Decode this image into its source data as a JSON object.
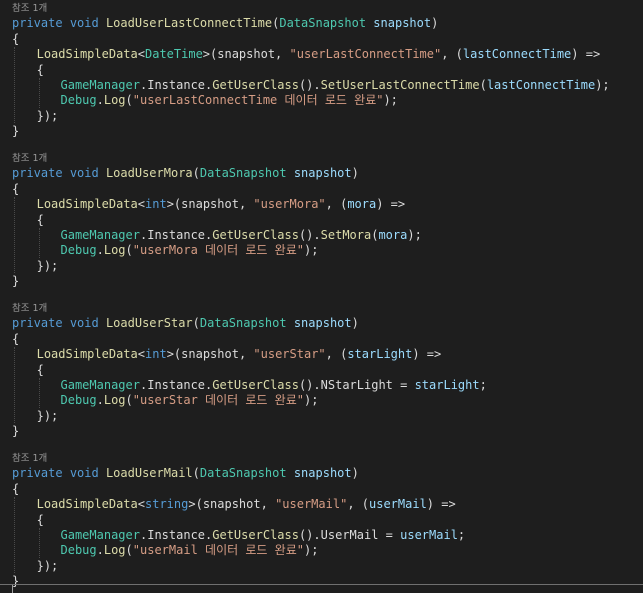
{
  "theme": {
    "background": "#1e1e1e",
    "keyword": "#569cd6",
    "type": "#4ec9b0",
    "method": "#dcdcaa",
    "string": "#d69d85",
    "parameter": "#9cdcfe",
    "text": "#dcdcdc",
    "codelens": "#999999"
  },
  "blocks": [
    {
      "references": "참조 1개",
      "modifier": "private",
      "return_type": "void",
      "method_name": "LoadUserLastConnectTime",
      "param_type": "DataSnapshot",
      "param_name": "snapshot",
      "call_name": "LoadSimpleData",
      "generic_type": "DateTime",
      "call_arg_snapshot": "snapshot",
      "key_string": "\"userLastConnectTime\"",
      "lambda_param": "lastConnectTime",
      "manager_class": "GameManager",
      "instance": "Instance",
      "get_user_class": "GetUserClass",
      "member": "SetUserLastConnectTime",
      "assign_kind": "call",
      "member_arg": "lastConnectTime",
      "debug_class": "Debug",
      "log_method": "Log",
      "log_string": "\"userLastConnectTime 데이터 로드 완료\""
    },
    {
      "references": "참조 1개",
      "modifier": "private",
      "return_type": "void",
      "method_name": "LoadUserMora",
      "param_type": "DataSnapshot",
      "param_name": "snapshot",
      "call_name": "LoadSimpleData",
      "generic_type": "int",
      "call_arg_snapshot": "snapshot",
      "key_string": "\"userMora\"",
      "lambda_param": "mora",
      "manager_class": "GameManager",
      "instance": "Instance",
      "get_user_class": "GetUserClass",
      "member": "SetMora",
      "assign_kind": "call",
      "member_arg": "mora",
      "debug_class": "Debug",
      "log_method": "Log",
      "log_string": "\"userMora 데이터 로드 완료\""
    },
    {
      "references": "참조 1개",
      "modifier": "private",
      "return_type": "void",
      "method_name": "LoadUserStar",
      "param_type": "DataSnapshot",
      "param_name": "snapshot",
      "call_name": "LoadSimpleData",
      "generic_type": "int",
      "call_arg_snapshot": "snapshot",
      "key_string": "\"userStar\"",
      "lambda_param": "starLight",
      "manager_class": "GameManager",
      "instance": "Instance",
      "get_user_class": "GetUserClass",
      "member": "NStarLight",
      "assign_kind": "assign",
      "member_arg": "starLight",
      "debug_class": "Debug",
      "log_method": "Log",
      "log_string": "\"userStar 데이터 로드 완료\""
    },
    {
      "references": "참조 1개",
      "modifier": "private",
      "return_type": "void",
      "method_name": "LoadUserMail",
      "param_type": "DataSnapshot",
      "param_name": "snapshot",
      "call_name": "LoadSimpleData",
      "generic_type": "string",
      "call_arg_snapshot": "snapshot",
      "key_string": "\"userMail\"",
      "lambda_param": "userMail",
      "manager_class": "GameManager",
      "instance": "Instance",
      "get_user_class": "GetUserClass",
      "member": "UserMail",
      "assign_kind": "assign",
      "member_arg": "userMail",
      "debug_class": "Debug",
      "log_method": "Log",
      "log_string": "\"userMail 데이터 로드 완료\""
    }
  ]
}
